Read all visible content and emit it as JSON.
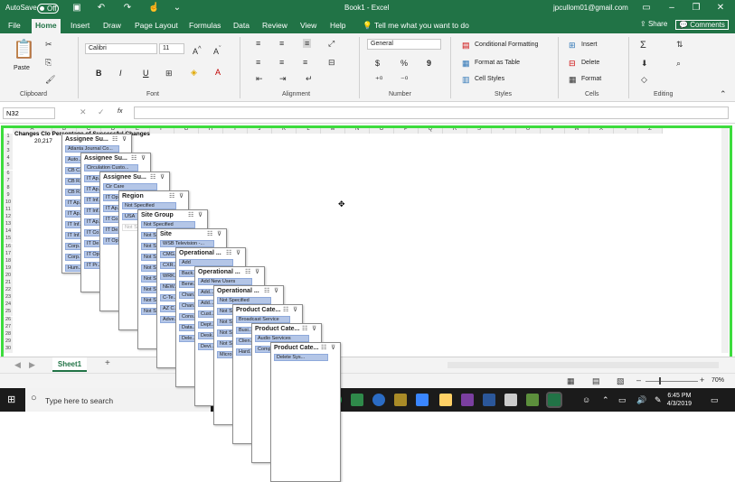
{
  "titlebar": {
    "autosave_label": "AutoSave",
    "autosave_state": "Off",
    "doc_title": "Book1 - Excel",
    "user": "jpcullom01@gmail.com"
  },
  "menu": {
    "tabs": [
      "File",
      "Home",
      "Insert",
      "Draw",
      "Page Layout",
      "Formulas",
      "Data",
      "Review",
      "View",
      "Help"
    ],
    "active": "Home",
    "tell_me": "Tell me what you want to do",
    "share": "Share",
    "comments": "Comments"
  },
  "ribbon": {
    "clipboard": {
      "paste": "Paste",
      "label": "Clipboard"
    },
    "font": {
      "name": "Calibri",
      "size": "11",
      "label": "Font",
      "bold": "B",
      "italic": "I",
      "underline": "U"
    },
    "alignment": {
      "label": "Alignment"
    },
    "number": {
      "format": "General",
      "label": "Number",
      "currency": "$",
      "percent": "%",
      "comma": "9"
    },
    "styles": {
      "conditional": "Conditional Formatting",
      "table": "Format as Table",
      "cell": "Cell Styles",
      "label": "Styles"
    },
    "cells": {
      "insert": "Insert",
      "delete": "Delete",
      "format": "Format",
      "label": "Cells"
    },
    "editing": {
      "label": "Editing"
    }
  },
  "formula_bar": {
    "name_box": "N32",
    "fx": "fx",
    "value": ""
  },
  "grid": {
    "columns": [
      "A",
      "B",
      "C",
      "D",
      "E",
      "F",
      "G",
      "H",
      "I",
      "J",
      "K",
      "L",
      "M",
      "N",
      "O",
      "P",
      "Q",
      "R",
      "S",
      "T",
      "U",
      "V",
      "W",
      "X",
      "Y",
      "Z"
    ],
    "rows": [
      "1",
      "2",
      "3",
      "4",
      "5",
      "6",
      "7",
      "8",
      "9",
      "10",
      "11",
      "12",
      "13",
      "14",
      "15",
      "16",
      "17",
      "18",
      "19",
      "20",
      "21",
      "22",
      "23",
      "24",
      "25",
      "26",
      "27",
      "28",
      "29",
      "30"
    ],
    "a1_text": "Changes Clo Percentage of Successful Changes",
    "a2_value": "20,217"
  },
  "slicers": [
    {
      "title": "Assignee Su...",
      "items": [
        "Atlanta Journal Co...",
        "Auto...",
        "CB C...",
        "CB R...",
        "CB R...",
        "IT Ap...",
        "IT Ap...",
        "IT Inf...",
        "IT Inf...",
        "Corp...",
        "Corp...",
        "Hum..."
      ]
    },
    {
      "title": "Assignee Su...",
      "items": [
        "Circulation Custo...",
        "IT Ap...",
        "IT Ap...",
        "IT Inf...",
        "IT Inf...",
        "IT Ap...",
        "IT Co...",
        "IT De...",
        "IT Op...",
        "IT Pr..."
      ]
    },
    {
      "title": "Assignee Su...",
      "items": [
        "Cir Care",
        "IT Op...",
        "IT Ap...",
        "IT Co...",
        "IT De...",
        "IT Op..."
      ]
    },
    {
      "title": "Region",
      "items": [
        "Not Specified",
        "USA",
        "Not S..."
      ]
    },
    {
      "title": "Site Group",
      "items": [
        "Not Specified",
        "Not S...",
        "Not S...",
        "Not S...",
        "Not S...",
        "Not S...",
        "Not S...",
        "Not S...",
        "Not S..."
      ]
    },
    {
      "title": "Site",
      "items": [
        "WSB Television -...",
        "CMG...",
        "CXR...",
        "WRK...",
        "NEW...",
        "C-Te...",
        "AZ C...",
        "Adve..."
      ]
    },
    {
      "title": "Operational ...",
      "items": [
        "Add",
        "Back...",
        "Bene...",
        "Chan...",
        "Chan...",
        "Cons...",
        "Data...",
        "Dele..."
      ]
    },
    {
      "title": "Operational ...",
      "items": [
        "Add New Users",
        "Add...",
        "Add...",
        "Cust...",
        "Dept...",
        "Desk...",
        "Devi..."
      ]
    },
    {
      "title": "Operational ...",
      "items": [
        "Not Specified",
        "Not S...",
        "Not S...",
        "Not S...",
        "Not S...",
        "Micro..."
      ]
    },
    {
      "title": "Product Cate...",
      "items": [
        "Broadcast Service",
        "Busi...",
        "Clien...",
        "Hard..."
      ]
    },
    {
      "title": "Product Cate...",
      "items": [
        "Audio Services",
        "Comp..."
      ]
    },
    {
      "title": "Product Cate...",
      "items": [
        "Delete Sys..."
      ]
    }
  ],
  "sheet": {
    "tab": "Sheet1",
    "add": "+"
  },
  "status": {
    "zoom": "70%"
  },
  "taskbar": {
    "search_placeholder": "Type here to search",
    "time": "6:45 PM",
    "date": "4/3/2019"
  },
  "colors": {
    "excel_green": "#217346",
    "highlight": "#3ddc3d",
    "slicer_item": "#b4c6e7"
  }
}
